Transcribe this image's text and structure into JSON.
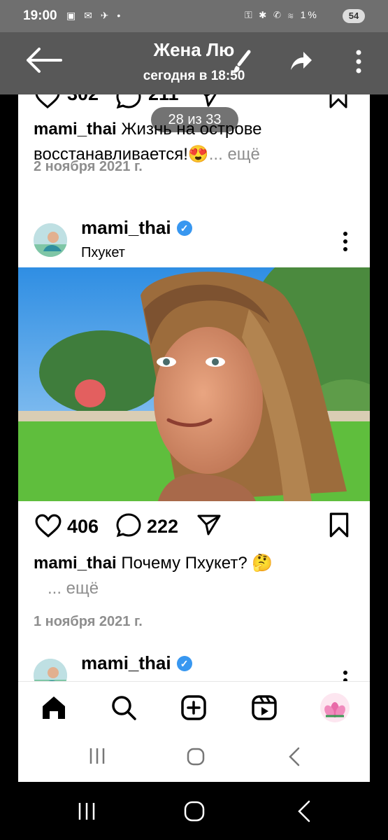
{
  "status_bar": {
    "time": "19:00",
    "left_icons": "▣ ✉ ✈ • ",
    "right_icons": "⚿ ✱ ✆ ≋ 1%",
    "battery": "54"
  },
  "viewer": {
    "title": "Жена Лю",
    "subtitle": "сегодня в 18:50",
    "counter": "28 из 33",
    "icons": [
      "back-arrow-icon",
      "brush-icon",
      "share-icon",
      "more-vertical-icon"
    ]
  },
  "prev_post": {
    "likes": "302",
    "comments": "211",
    "caption_user": "mami_thai",
    "caption_line1": "Жизнь на острове",
    "caption_line2": "восстанавливается!😍",
    "more": "... ещё",
    "date": "2 ноября 2021 г."
  },
  "post": {
    "username": "mami_thai",
    "location": "Пхукет",
    "likes": "406",
    "comments": "222",
    "caption_user": "mami_thai",
    "caption_text": "Почему Пхукет? 🤔",
    "more": "... ещё",
    "date": "1 ноября 2021 г."
  },
  "next_post": {
    "username": "mami_thai"
  },
  "bottom_nav": [
    "home-icon",
    "search-icon",
    "create-icon",
    "reels-icon",
    "profile-avatar"
  ],
  "colors": {
    "verified": "#3897f0",
    "muted_text": "#8e8e8e",
    "overlay": "#5f5f5f"
  }
}
